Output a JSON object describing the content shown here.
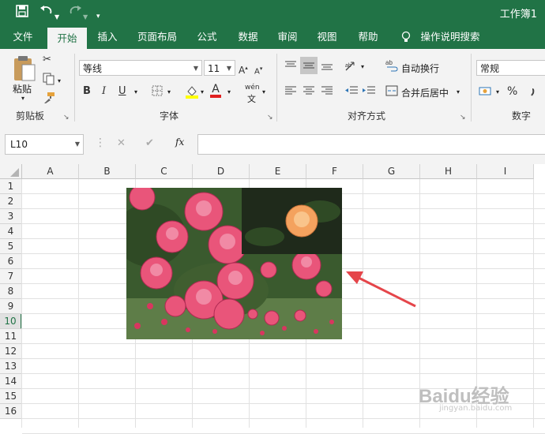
{
  "titlebar": {
    "app_title": "工作簿1"
  },
  "tabs": [
    "文件",
    "开始",
    "插入",
    "页面布局",
    "公式",
    "数据",
    "审阅",
    "视图",
    "帮助",
    "操作说明搜索"
  ],
  "clipboard": {
    "paste_label": "粘贴",
    "group_label": "剪贴板"
  },
  "font": {
    "font_name": "等线",
    "font_size": "11",
    "bold": "B",
    "italic": "I",
    "underline": "U",
    "font_color_glyph": "A",
    "wen_glyph": "wén",
    "group_label": "字体"
  },
  "alignment": {
    "wrap_text": "自动换行",
    "merge_center": "合并后居中",
    "group_label": "对齐方式"
  },
  "number": {
    "format": "常规",
    "percent": "%",
    "group_label": "数字"
  },
  "formula_bar": {
    "name_box": "L10",
    "fx": "fx",
    "cancel": "✕",
    "confirm": "✔"
  },
  "columns": [
    "A",
    "B",
    "C",
    "D",
    "E",
    "F",
    "G",
    "H",
    "I"
  ],
  "rows": [
    "1",
    "2",
    "3",
    "4",
    "5",
    "6",
    "7",
    "8",
    "9",
    "10",
    "11",
    "12",
    "13",
    "14",
    "15",
    "16"
  ],
  "selected_row": "10",
  "watermark": {
    "main": "Baidu经验",
    "sub": "jingyan.baidu.com"
  },
  "colors": {
    "excel_green": "#217346",
    "arrow_red": "#e5454a"
  }
}
